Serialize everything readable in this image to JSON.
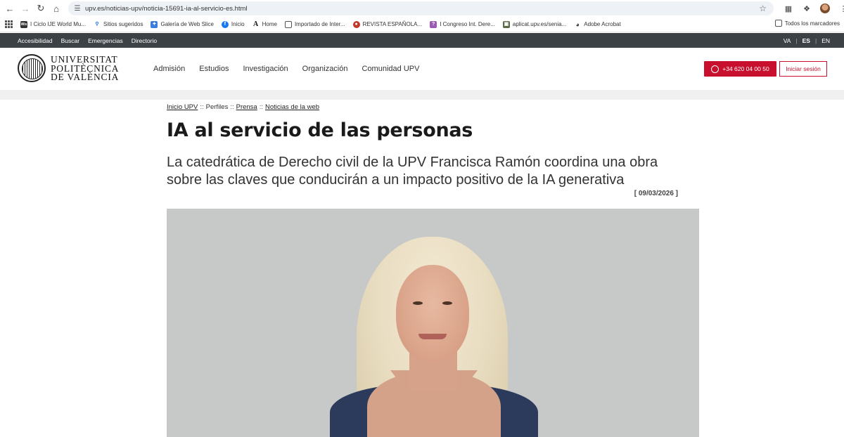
{
  "browser": {
    "url": "upv.es/noticias-upv/noticia-15691-ia-al-servicio-es.html",
    "bookmarks": [
      {
        "label": "I Ciclo IJE World Mu...",
        "icon": "wix-icon"
      },
      {
        "label": "Sitios sugeridos",
        "icon": "search-icon"
      },
      {
        "label": "Galería de Web Slice",
        "icon": "ie-slice-icon"
      },
      {
        "label": "Inicio",
        "icon": "facebook-icon"
      },
      {
        "label": "Home",
        "icon": "a-letter-icon"
      },
      {
        "label": "Importado de Inter...",
        "icon": "folder-icon"
      },
      {
        "label": "REVISTA ESPAÑOLA...",
        "icon": "revista-icon"
      },
      {
        "label": "I Congreso Int. Dere...",
        "icon": "congreso-icon"
      },
      {
        "label": "aplicat.upv.es/senia...",
        "icon": "upv-icon"
      },
      {
        "label": "Adobe Acrobat",
        "icon": "globe-icon"
      }
    ],
    "all_bookmarks": "Todos los marcadores"
  },
  "topbar": {
    "links": [
      "Accesibilidad",
      "Buscar",
      "Emergencias",
      "Directorio"
    ],
    "languages": [
      "VA",
      "ES",
      "EN"
    ],
    "active_language": "ES"
  },
  "header": {
    "logo_lines": [
      "UNIVERSITAT",
      "POLITÈCNICA",
      "DE VALÈNCIA"
    ],
    "nav": [
      "Admisión",
      "Estudios",
      "Investigación",
      "Organización",
      "Comunidad UPV"
    ],
    "phone": "+34 620 04 00 50",
    "login": "Iniciar sesión"
  },
  "article": {
    "breadcrumb": [
      {
        "label": "Inicio UPV",
        "link": true
      },
      {
        "label": "Perfiles",
        "link": false
      },
      {
        "label": "Prensa",
        "link": true
      },
      {
        "label": "Noticias de la web",
        "link": true
      }
    ],
    "breadcrumb_sep": "::",
    "title": "IA al servicio de las personas",
    "subtitle": "La catedrática de Derecho civil de la UPV Francisca Ramón coordina una obra sobre las claves que conducirán a un impacto positivo de la IA generativa",
    "date": "[ 09/03/2026 ]"
  },
  "colors": {
    "brand_red": "#c8102e",
    "topbar_bg": "#3c4146",
    "photo_bg": "#c7c8c8"
  }
}
